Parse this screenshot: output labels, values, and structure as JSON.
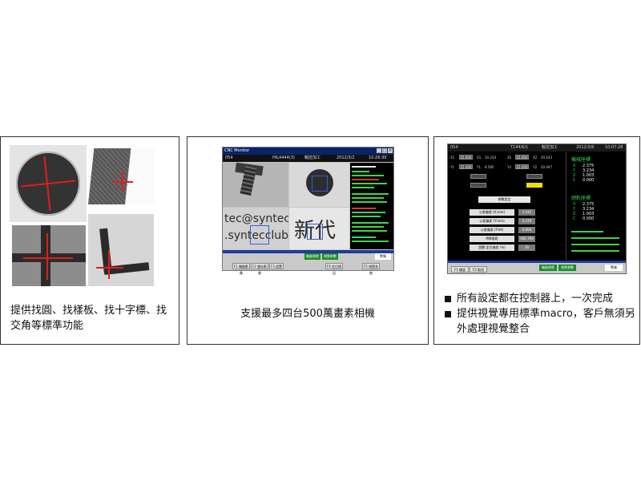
{
  "panel1": {
    "caption": "提供找圓、找樣板、找十字標、找交角等標準功能"
  },
  "panel2": {
    "caption": "支援最多四台500萬畫素相機",
    "screen": {
      "title": "CNC Monitor",
      "status": [
        "054",
        "HIL4444(3)",
        "輸控加工",
        "2012/3/2",
        "10:26:30"
      ],
      "image_text": [
        "tec@syntec",
        ".syntecclub.",
        "新代"
      ],
      "tabs": [
        "機器視覺",
        "視覺參數",
        "警報"
      ],
      "softkeys": [
        "F1 開啟影像",
        "F2 儲存影像",
        "F3 設置",
        "F4 定位標記",
        "F5 視覺系統"
      ]
    }
  },
  "panel3": {
    "bullets": [
      "所有設定都在控制器上，一次完成",
      "提供視覺專用標準macro，客戶無須另外處理視覺整合"
    ],
    "screen": {
      "status": [
        "054",
        "T144/6/1",
        "輸控加工",
        "2012/3/6",
        "10:07:28"
      ],
      "params": [
        {
          "k": "X1",
          "v": "25.000"
        },
        {
          "k": "X1",
          "v": "10.234"
        },
        {
          "k": "X2",
          "v": "25.000"
        },
        {
          "k": "X2",
          "v": "20.633"
        },
        {
          "k": "Y1",
          "v": "25.000"
        },
        {
          "k": "Y1",
          "v": "9.585"
        },
        {
          "k": "Y2",
          "v": "25.000"
        },
        {
          "k": "Y2",
          "v": "20.447"
        }
      ],
      "menu_title": "參數設定",
      "menu": [
        {
          "label": "公差偏差 (X:mm)",
          "value": "1.415"
        },
        {
          "label": "公差偏差 (Y:mm)",
          "value": "0.276"
        },
        {
          "label": "公差偏差 (THA)",
          "value": "0.000"
        },
        {
          "label": "IMB差距",
          "value": "000.700"
        },
        {
          "label": "設數 定位偏差 (%)",
          "value": "30"
        }
      ],
      "machine_coord_title": "機械座標",
      "machine_coord": [
        {
          "axis": "X",
          "value": "2.375"
        },
        {
          "axis": "Y",
          "value": "3.234"
        },
        {
          "axis": "Z",
          "value": "1.003"
        },
        {
          "axis": "C",
          "value": "0.000"
        }
      ],
      "abs_coord_title": "絕對座標",
      "abs_coord": [
        {
          "axis": "X",
          "value": "2.375"
        },
        {
          "axis": "Y",
          "value": "3.234"
        },
        {
          "axis": "Z",
          "value": "1.003"
        },
        {
          "axis": "C",
          "value": "0.000"
        }
      ],
      "tabs": [
        "機器視覺",
        "視覺參數",
        "警報"
      ],
      "softkeys": [
        "F1 確認",
        "F2 取消"
      ]
    }
  }
}
